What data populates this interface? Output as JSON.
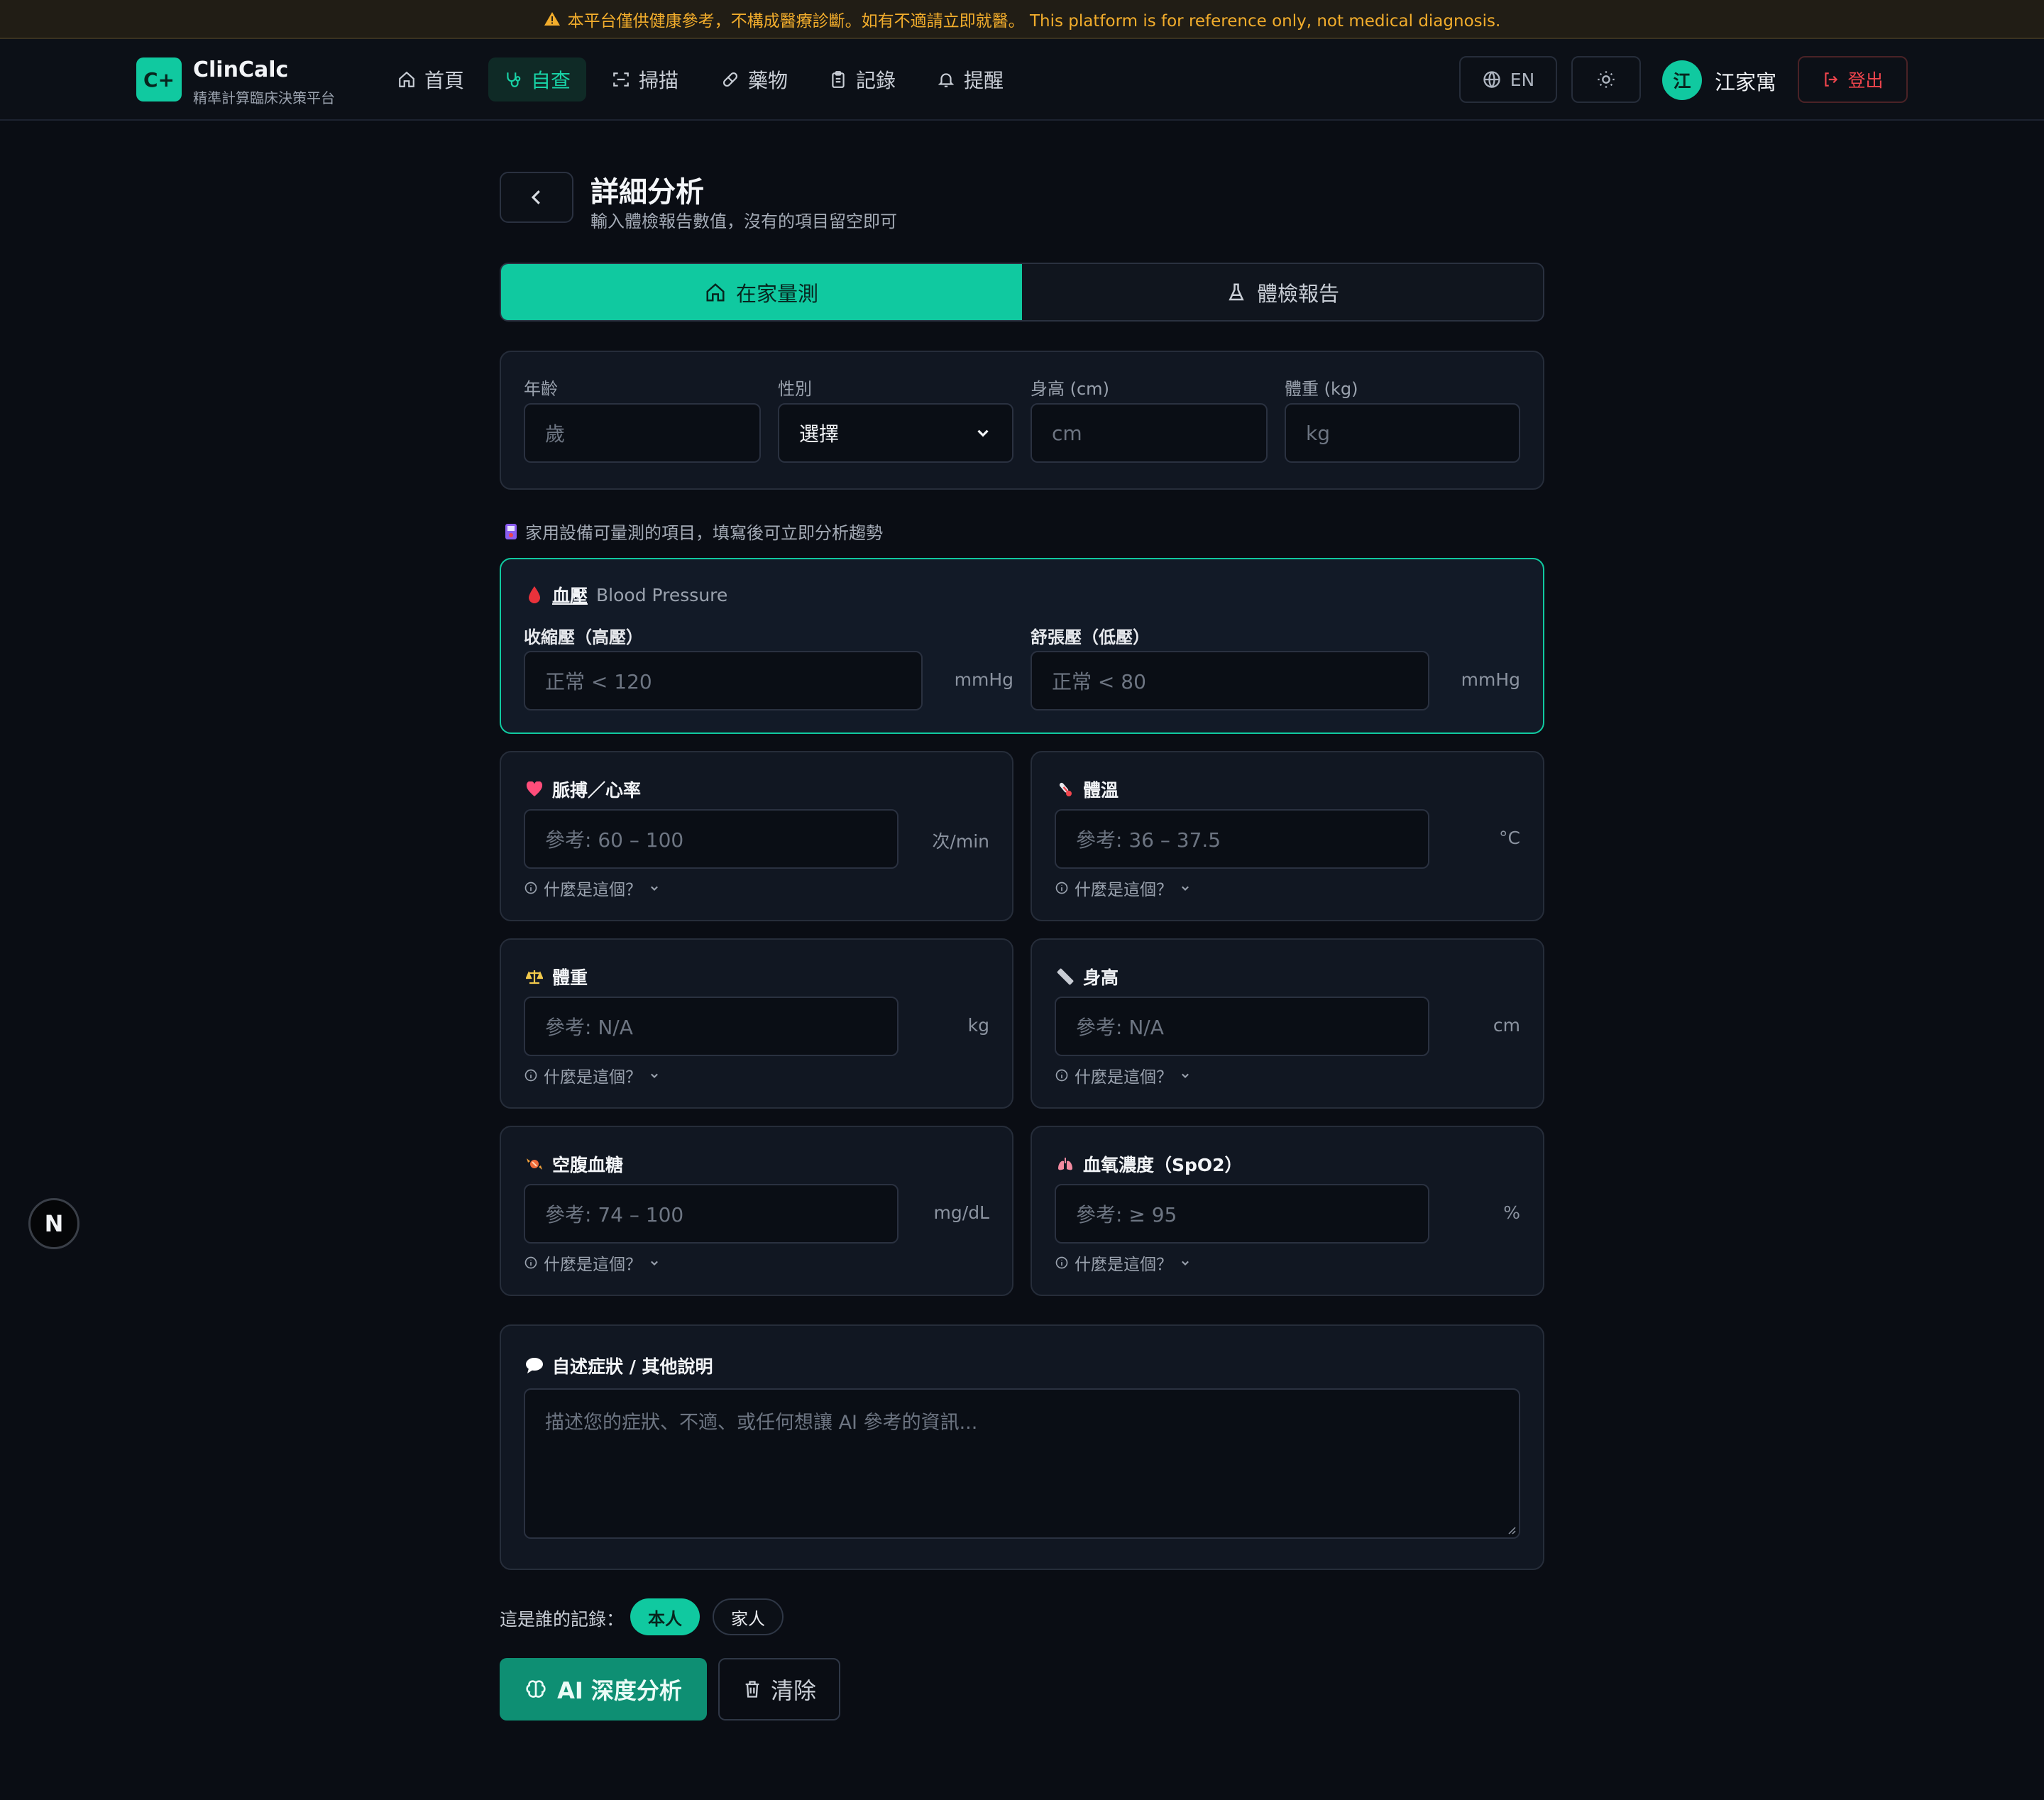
{
  "disclaimer": "本平台僅供健康參考，不構成醫療診斷。如有不適請立即就醫。 This platform is for reference only, not medical diagnosis.",
  "brand": {
    "logo": "C+",
    "name": "ClinCalc",
    "tagline": "精準計算臨床決策平台"
  },
  "nav": {
    "items": [
      {
        "label": "首頁",
        "icon": "home-icon",
        "active": false
      },
      {
        "label": "自查",
        "icon": "stethoscope-icon",
        "active": true
      },
      {
        "label": "掃描",
        "icon": "scan-icon",
        "active": false
      },
      {
        "label": "藥物",
        "icon": "pill-icon",
        "active": false
      },
      {
        "label": "記錄",
        "icon": "clipboard-icon",
        "active": false
      },
      {
        "label": "提醒",
        "icon": "bell-icon",
        "active": false
      }
    ],
    "language_label": "EN",
    "user_initial": "江",
    "user_name": "江家寓",
    "logout_label": "登出"
  },
  "page": {
    "title": "詳細分析",
    "subtitle": "輸入體檢報告數值，沒有的項目留空即可"
  },
  "tabs": [
    {
      "label": "在家量測",
      "icon": "home-icon",
      "active": true
    },
    {
      "label": "體檢報告",
      "icon": "flask-icon",
      "active": false
    }
  ],
  "basic": {
    "age_label": "年齡",
    "age_placeholder": "歲",
    "sex_label": "性別",
    "sex_value": "選擇",
    "height_label": "身高 (cm)",
    "height_placeholder": "cm",
    "weight_label": "體重 (kg)",
    "weight_placeholder": "kg"
  },
  "home_hint": "家用設備可量測的項目，填寫後可立即分析趨勢",
  "bp": {
    "title": "血壓",
    "subtitle": "Blood Pressure",
    "systolic_label": "收縮壓（高壓）",
    "systolic_placeholder": "正常 < 120",
    "systolic_unit": "mmHg",
    "diastolic_label": "舒張壓（低壓）",
    "diastolic_placeholder": "正常 < 80",
    "diastolic_unit": "mmHg"
  },
  "metrics": [
    {
      "title": "脈搏／心率",
      "icon": "heart-icon",
      "placeholder": "參考: 60 – 100",
      "unit": "次/min",
      "help": "什麼是這個？"
    },
    {
      "title": "體溫",
      "icon": "thermometer-icon",
      "placeholder": "參考: 36 – 37.5",
      "unit": "°C",
      "help": "什麼是這個？"
    },
    {
      "title": "體重",
      "icon": "scale-icon",
      "placeholder": "參考: N/A",
      "unit": "kg",
      "help": "什麼是這個？"
    },
    {
      "title": "身高",
      "icon": "ruler-icon",
      "placeholder": "參考: N/A",
      "unit": "cm",
      "help": "什麼是這個？"
    },
    {
      "title": "空腹血糖",
      "icon": "candy-icon",
      "placeholder": "參考: 74 – 100",
      "unit": "mg/dL",
      "help": "什麼是這個？"
    },
    {
      "title": "血氧濃度（SpO2）",
      "icon": "lungs-icon",
      "placeholder": "參考: ≥ 95",
      "unit": "%",
      "help": "什麼是這個？"
    }
  ],
  "symptoms": {
    "title": "自述症狀 / 其他說明",
    "placeholder": "描述您的症狀、不適、或任何想讓 AI 參考的資訊..."
  },
  "owner": {
    "label": "這是誰的記錄：",
    "options": [
      "本人",
      "家人"
    ],
    "selected": "本人"
  },
  "actions": {
    "analyze_label": "AI 深度分析",
    "clear_label": "清除"
  },
  "dev_badge": "N",
  "colors": {
    "accent": "#10c9a0",
    "warning": "#f2ad2c",
    "danger": "#f0454d",
    "background": "#0a0d14"
  }
}
